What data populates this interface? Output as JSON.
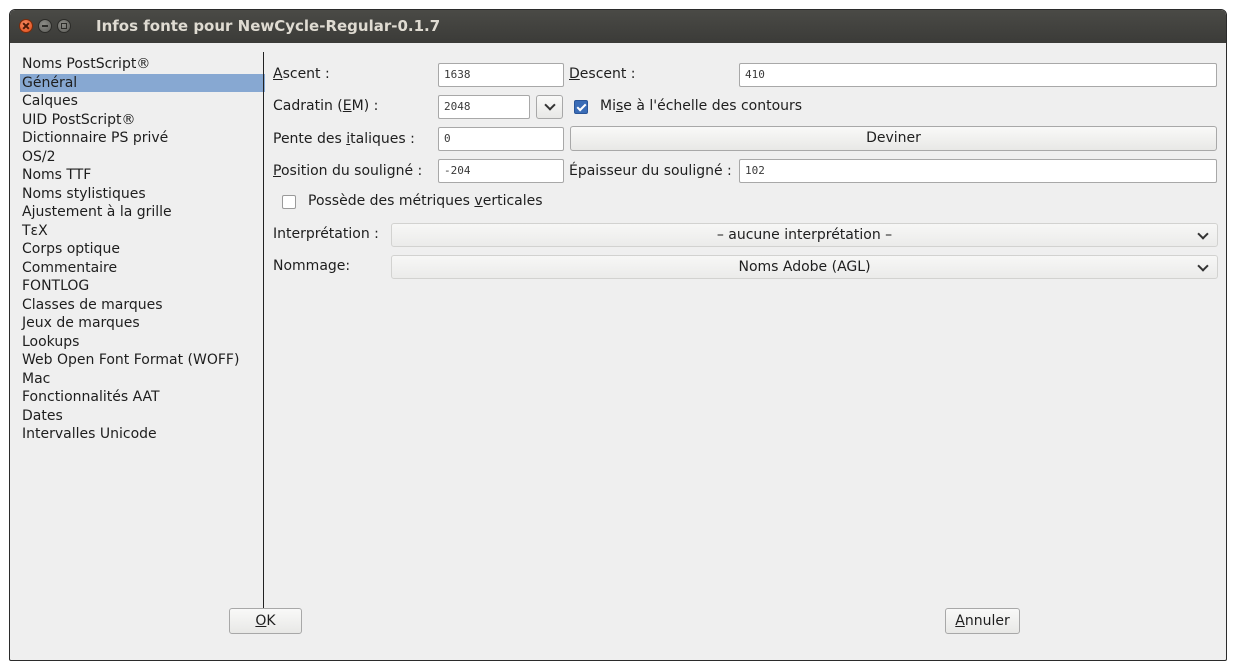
{
  "window": {
    "title": "Infos fonte pour NewCycle-Regular-0.1.7"
  },
  "sidebar": {
    "items": [
      {
        "label": "Noms PostScript®"
      },
      {
        "label": "Général",
        "selected": true
      },
      {
        "label": "Calques"
      },
      {
        "label": "UID PostScript®"
      },
      {
        "label": "Dictionnaire PS privé"
      },
      {
        "label": "OS/2"
      },
      {
        "label": "Noms TTF"
      },
      {
        "label": "Noms stylistiques"
      },
      {
        "label": "Ajustement à la grille"
      },
      {
        "label": "TεX"
      },
      {
        "label": "Corps optique"
      },
      {
        "label": "Commentaire"
      },
      {
        "label": "FONTLOG"
      },
      {
        "label": "Classes de marques"
      },
      {
        "label": "Jeux de marques"
      },
      {
        "label": "Lookups"
      },
      {
        "label": "Web Open Font Format (WOFF)"
      },
      {
        "label": "Mac"
      },
      {
        "label": "Fonctionnalités AAT"
      },
      {
        "label": "Dates"
      },
      {
        "label": "Intervalles Unicode"
      }
    ]
  },
  "general": {
    "ascent": {
      "label_u": "A",
      "label_rest": "scent :",
      "value": "1638"
    },
    "descent": {
      "label_u": "D",
      "label_rest": "escent :",
      "value": "410"
    },
    "em": {
      "label_pre": "Cadratin (",
      "label_u": "E",
      "label_post": "M) :",
      "value": "2048"
    },
    "scale_outlines": {
      "label_pre": "Mi",
      "label_u": "s",
      "label_post": "e à l'échelle des contours",
      "checked": true
    },
    "italic_angle": {
      "label_pre": "Pente des ",
      "label_u": "i",
      "label_post": "taliques :",
      "value": "0"
    },
    "guess_button": "Deviner",
    "underline_pos": {
      "label_u": "P",
      "label_rest": "osition du souligné :",
      "value": "-204"
    },
    "underline_width": {
      "label": "Épaisseur du souligné :",
      "value": "102"
    },
    "vertical_metrics": {
      "label_pre": "Possède des métriques ",
      "label_u": "v",
      "label_post": "erticales",
      "checked": false
    },
    "interpretation": {
      "label": "Interprétation :",
      "value": "– aucune interprétation –"
    },
    "naming": {
      "label": "Nommage:",
      "value": "Noms Adobe (AGL)"
    }
  },
  "buttons": {
    "ok_u": "O",
    "ok_rest": "K",
    "cancel_u": "A",
    "cancel_rest": "nnuler"
  },
  "icons": [
    "close-icon",
    "minimize-icon",
    "maximize-icon",
    "chevron-down-icon",
    "checkmark-icon"
  ],
  "colors": {
    "selection": "#87a8d2",
    "checkbox": "#3a6cb6",
    "titlebar": "#3c3c3a"
  }
}
